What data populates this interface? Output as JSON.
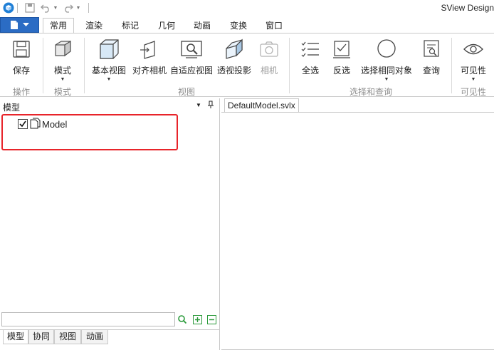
{
  "app": {
    "title": "SView Design"
  },
  "colors": {
    "accent": "#2b6cc4",
    "highlight": "#e8242a"
  },
  "quick_access": {
    "icons": [
      "app-logo-icon",
      "save-icon",
      "undo-icon",
      "redo-icon"
    ]
  },
  "tabs": [
    {
      "label": "常用",
      "active": true
    },
    {
      "label": "渲染"
    },
    {
      "label": "标记"
    },
    {
      "label": "几何"
    },
    {
      "label": "动画"
    },
    {
      "label": "变换"
    },
    {
      "label": "窗口"
    }
  ],
  "ribbon": {
    "buttons": {
      "save": "保存",
      "mode": "模式",
      "basic_view": "基本视图",
      "align_camera": "对齐相机",
      "fit_view": "自适应视图",
      "perspective": "透视投影",
      "camera": "相机",
      "select_all": "全选",
      "invert": "反选",
      "select_same": "选择相同对象",
      "query": "查询",
      "visibility": "可见性"
    },
    "groups": {
      "operation": "操作",
      "mode": "模式",
      "view": "视图",
      "select_query": "选择和查询",
      "visibility": "可见性"
    }
  },
  "panel": {
    "title": "模型",
    "tree": {
      "item_label": "Model",
      "checked": true
    },
    "search": {
      "value": ""
    },
    "bottom_tabs": [
      {
        "label": "模型",
        "active": true
      },
      {
        "label": "协同"
      },
      {
        "label": "视图"
      },
      {
        "label": "动画"
      }
    ]
  },
  "document": {
    "tab_label": "DefaultModel.svlx"
  }
}
